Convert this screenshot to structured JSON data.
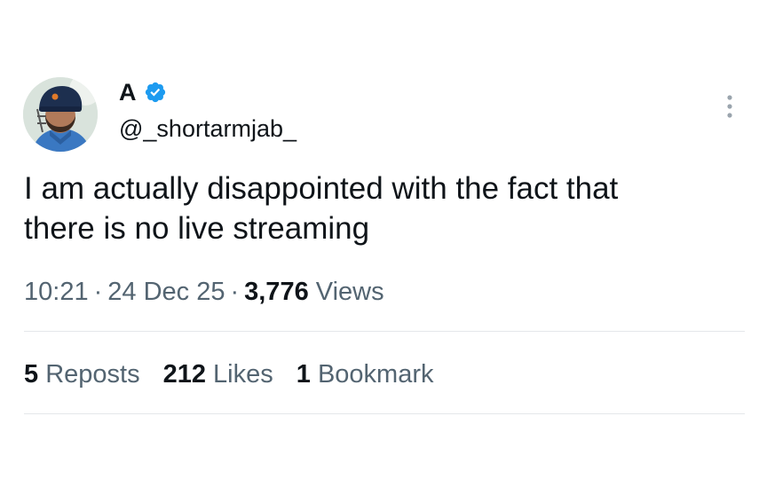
{
  "author": {
    "display_name": "A",
    "handle": "@_shortarmjab_",
    "verified": true,
    "verified_color": "#1d9bf0",
    "avatar_icon": "profile-photo-cricketer-helmet"
  },
  "tweet": {
    "text_line1": "I am actually disappointed with the fact that",
    "text_line2": "there is no live streaming"
  },
  "meta": {
    "time": "10:21",
    "separator": "·",
    "date": "24 Dec 25",
    "views_count": "3,776",
    "views_label": "Views"
  },
  "stats": {
    "reposts_count": "5",
    "reposts_label": "Reposts",
    "likes_count": "212",
    "likes_label": "Likes",
    "bookmarks_count": "1",
    "bookmarks_label": "Bookmark"
  },
  "icons": {
    "more": "more-options-icon",
    "verified": "verified-badge-icon"
  },
  "colors": {
    "text_primary": "#0f1419",
    "text_secondary": "#536471",
    "divider": "#e4e7ea"
  }
}
